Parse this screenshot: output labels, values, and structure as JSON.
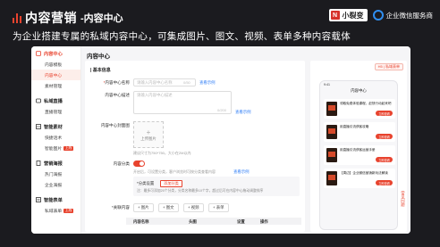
{
  "header": {
    "title": "内容营销",
    "subtitle": "-内容中心",
    "slogan": "为企业搭建专属的私域内容中心，可集成图片、图文、视频、表单多种内容载体",
    "logo_left_mark": "N",
    "logo_left_name": "小裂变",
    "logo_right_name": "企业微信服务商"
  },
  "sidebar": {
    "groups": [
      {
        "label": "内容中心",
        "items": [
          {
            "label": "内容模板"
          },
          {
            "label": "内容中心"
          },
          {
            "label": "素材管理"
          }
        ]
      },
      {
        "label": "私域直播",
        "items": [
          {
            "label": "直播管理"
          }
        ]
      },
      {
        "label": "智能素材",
        "items": [
          {
            "label": "快捷话术"
          },
          {
            "label": "智能图片",
            "badge": "上线"
          }
        ]
      },
      {
        "label": "营销海报",
        "items": [
          {
            "label": "热门海报"
          },
          {
            "label": "企业海报"
          }
        ]
      },
      {
        "label": "智能表单",
        "items": [
          {
            "label": "私域表单",
            "badge": "上线"
          }
        ]
      }
    ],
    "active_item": "内容中心"
  },
  "main": {
    "page_title": "内容中心",
    "section_title": "基本信息",
    "name_label": "内容中心名称",
    "name_placeholder": "请输入内容中心名称",
    "name_counter": "0/50",
    "name_link": "查看示例",
    "desc_label": "内容中心描述",
    "desc_placeholder": "请输入内容中心描述",
    "desc_counter": "0/200",
    "desc_link": "查看示例",
    "cover_label": "内容中心封面图",
    "upload_label": "上传图片",
    "upload_hint": "建议尺寸为750*750，大小在2M以内",
    "share_label": "内容分类",
    "share_hint": "开启后，可设置分类，客户浏览时可按分类查看内容",
    "share_link": "查看示例",
    "class_label": "*分类设置",
    "class_option": "添加分类",
    "class_note": "注：最多可添加20个分类，分类名称最多10个字，超过后可在内容中心拖动调整排序",
    "content_label": "*关联内容",
    "content_buttons": [
      "+ 图片",
      "+ 图文",
      "+ 视频",
      "+ 表单"
    ],
    "table_headers": [
      "内容名称",
      "头图",
      "设置",
      "操作"
    ]
  },
  "preview": {
    "tag": "H5 | 私域表单",
    "status_time": "9:41",
    "phone_title": "内容中心",
    "cards": [
      {
        "title": "领取免费体验课程，赶快行动起来吧",
        "button": "立即查看"
      },
      {
        "title": "用直播引流获客攻略",
        "button": "立即查看"
      },
      {
        "title": "用直播引流获客运营手册",
        "button": "立即查看"
      },
      {
        "title": "【周边】企业微信营销新玩法解读",
        "button": "立即查看"
      }
    ]
  },
  "side_tab": "常见问题",
  "colors": {
    "accent": "#e8432e",
    "link": "#2f7df6",
    "background": "#1b1b1f"
  }
}
